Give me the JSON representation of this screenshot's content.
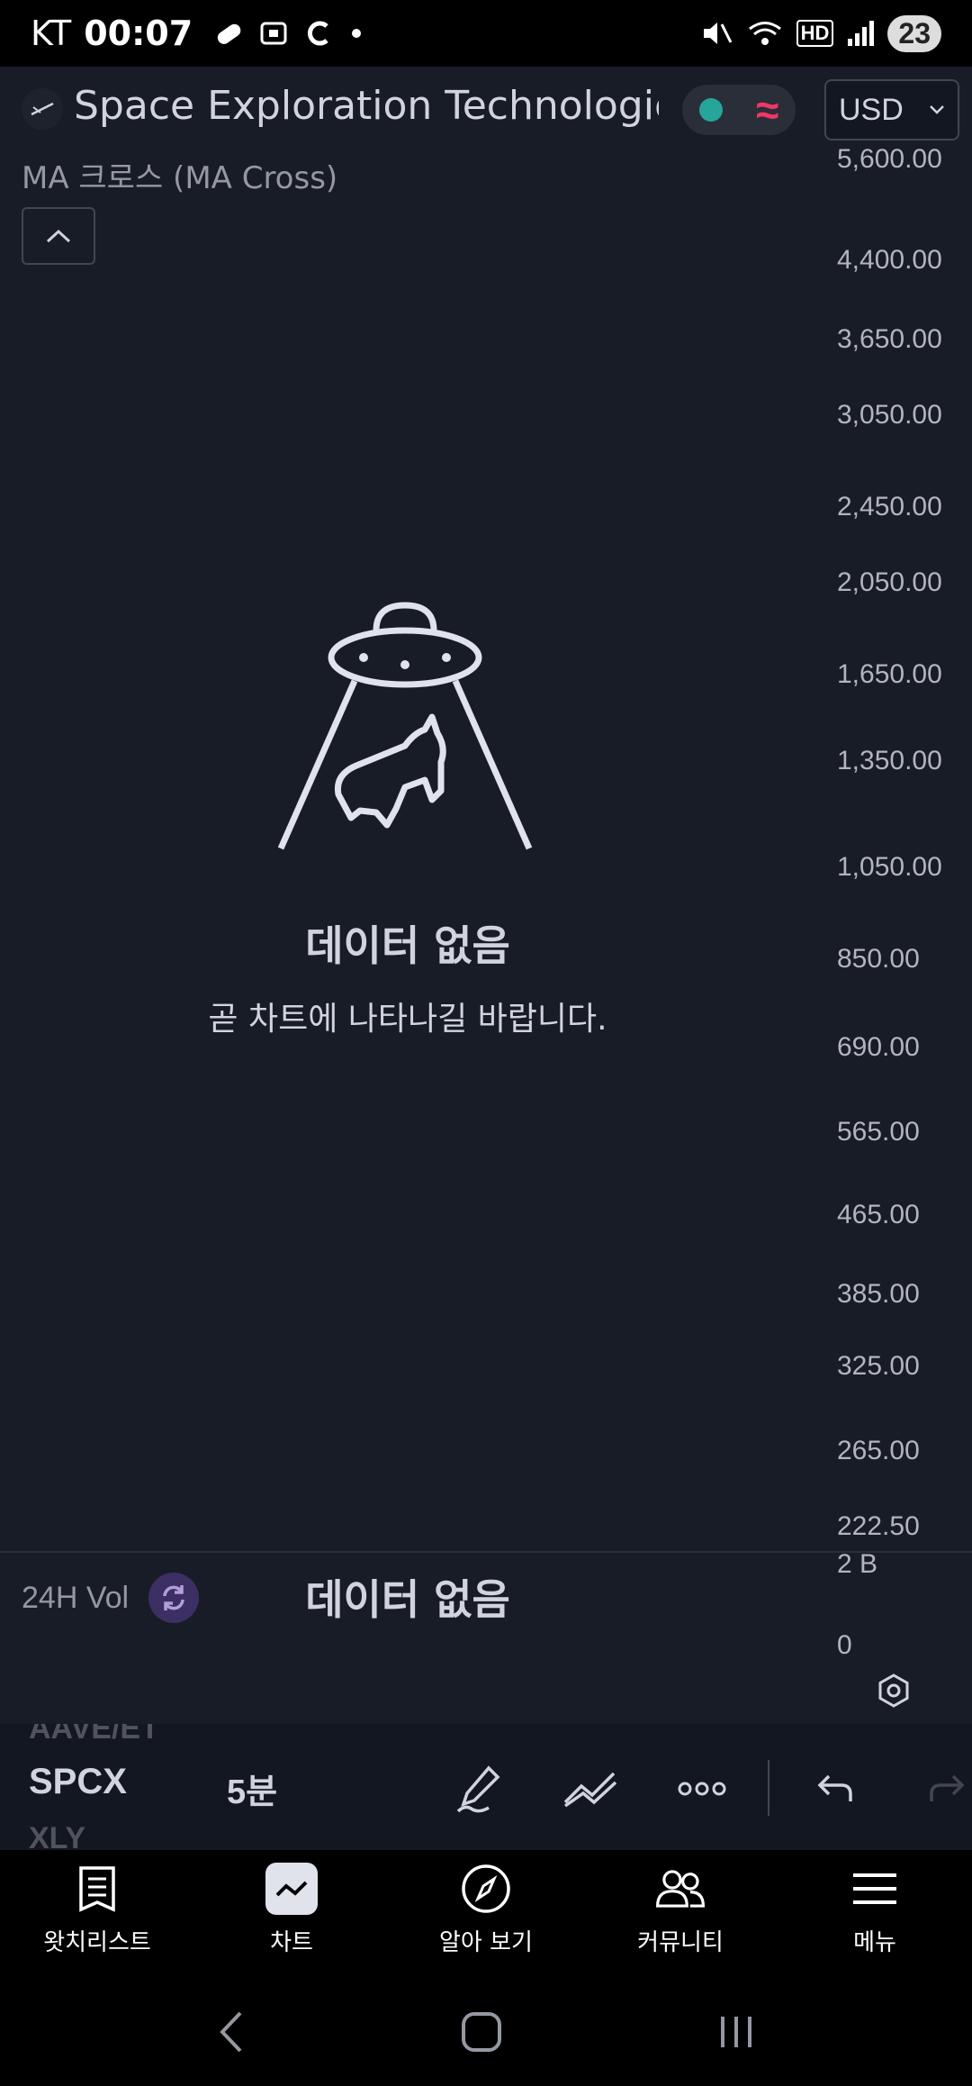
{
  "status_bar": {
    "carrier": "KT",
    "time": "00:07",
    "battery": "23",
    "network_badge": "HD"
  },
  "header": {
    "symbol_title": "Space Exploration Technologie···",
    "currency": "USD"
  },
  "indicator": {
    "label": "MA 크로스 (MA Cross)"
  },
  "price_axis": [
    "5,600.00",
    "4,400.00",
    "3,650.00",
    "3,050.00",
    "2,450.00",
    "2,050.00",
    "1,650.00",
    "1,350.00",
    "1,050.00",
    "850.00",
    "690.00",
    "565.00",
    "465.00",
    "385.00",
    "325.00",
    "265.00",
    "222.50"
  ],
  "empty_state": {
    "title": "데이터 없음",
    "subtitle": "곧 차트에 나타나길 바랍니다."
  },
  "volume_pane": {
    "label": "24H Vol",
    "nodata": "데이터 없음",
    "axis_top": "2 B",
    "axis_bottom": "0"
  },
  "toolbar": {
    "ghost_above": "AAVE/ET",
    "symbol": "SPCX",
    "ghost_below": "XLY",
    "interval": "5분"
  },
  "bottom_nav": {
    "items": [
      {
        "label": "왓치리스트",
        "icon": "watchlist-icon"
      },
      {
        "label": "차트",
        "icon": "chart-icon"
      },
      {
        "label": "알아 보기",
        "icon": "compass-icon"
      },
      {
        "label": "커뮤니티",
        "icon": "community-icon"
      },
      {
        "label": "메뉴",
        "icon": "menu-icon"
      }
    ]
  },
  "colors": {
    "background": "#181c27",
    "accent_green": "#26a69a",
    "accent_pink": "#f23665"
  }
}
